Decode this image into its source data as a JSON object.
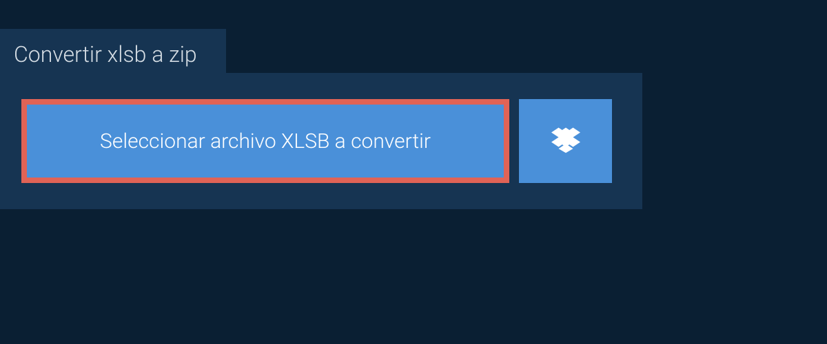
{
  "header": {
    "title": "Convertir xlsb a zip"
  },
  "actions": {
    "select_file_label": "Seleccionar archivo XLSB a convertir",
    "dropbox_icon_name": "dropbox-icon"
  },
  "colors": {
    "background": "#0a1f33",
    "panel": "#163452",
    "button": "#4a90d9",
    "button_border": "#e06356",
    "text_light": "#d5dde4",
    "text_white": "#ffffff"
  }
}
